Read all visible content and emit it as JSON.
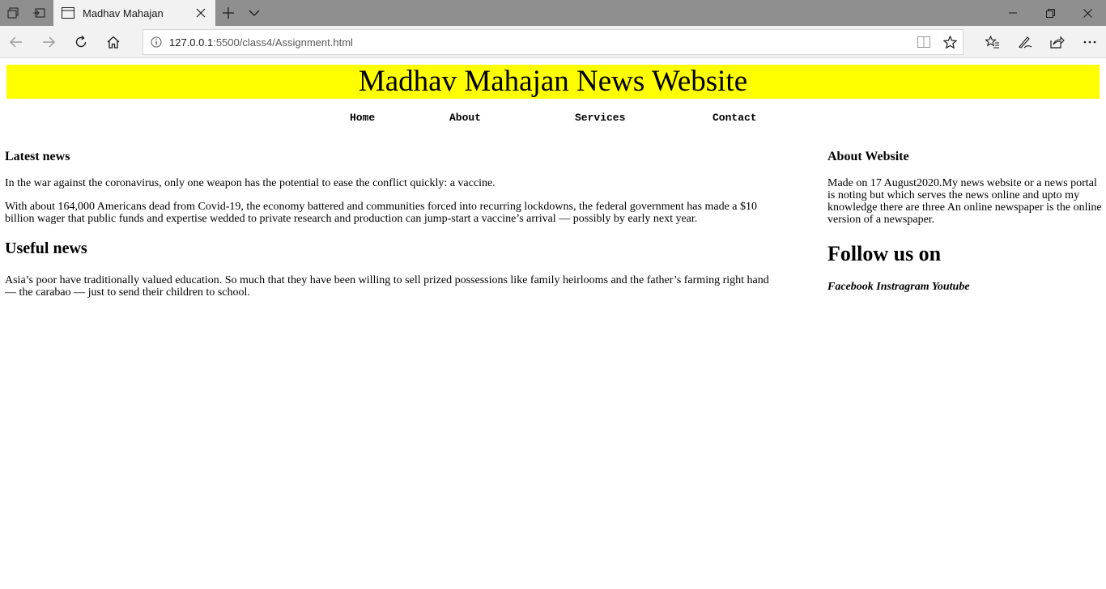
{
  "browser": {
    "tab_title": "Madhav Mahajan",
    "url_host": "127.0.0.1",
    "url_path": ":5500/class4/Assignment.html"
  },
  "page": {
    "header_title": "Madhav Mahajan News Website",
    "nav": {
      "home": "Home",
      "about": "About",
      "services": "Services",
      "contact": "Contact"
    },
    "main": {
      "latest_heading": "Latest news",
      "latest_p1": "In the war against the coronavirus, only one weapon has the potential to ease the conflict quickly: a vaccine.",
      "latest_p2": "With about 164,000 Americans dead from Covid-19, the economy battered and communities forced into recurring lockdowns, the federal government has made a $10 billion wager that public funds and expertise wedded to private research and production can jump-start a vaccine’s arrival — possibly by early next year.",
      "useful_heading": "Useful news",
      "useful_p1": "Asia’s poor have traditionally valued education. So much that they have been willing to sell prized possessions like family heirlooms and the father’s farming right hand — the carabao — just to send their children to school."
    },
    "side": {
      "about_heading": "About Website",
      "about_text": "Made on 17 August2020.My news website or a news portal is noting but which serves the news online and upto my knowledge there are three An online newspaper is the online version of a newspaper.",
      "follow_heading": "Follow us on",
      "social": {
        "facebook": "Facebook",
        "instagram": "Instragram",
        "youtube": "Youtube"
      }
    }
  },
  "colors": {
    "header_bg": "#ffff00",
    "tabbar_bg": "#8f8f8f",
    "toolbar_bg": "#f2f2f2"
  }
}
